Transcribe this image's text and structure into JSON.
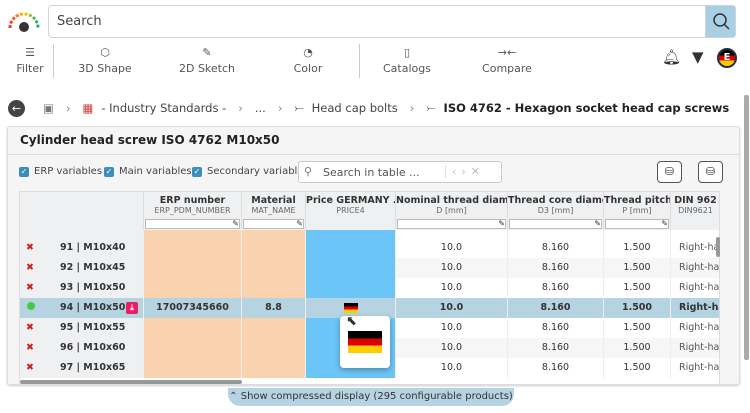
{
  "search": {
    "placeholder": "Search"
  },
  "toolbar": [
    {
      "label": "Filter",
      "icon": "sliders-icon"
    },
    {
      "label": "3D Shape",
      "icon": "cube-icon"
    },
    {
      "label": "2D Sketch",
      "icon": "pencil-icon"
    },
    {
      "label": "Color",
      "icon": "palette-icon"
    },
    {
      "label": "Catalogs",
      "icon": "book-icon"
    },
    {
      "label": "Compare",
      "icon": "compare-icon"
    }
  ],
  "user": {
    "avatar_letter": "E"
  },
  "breadcrumb": [
    "- Industry Standards -",
    "...",
    "Head cap bolts",
    "ISO 4762 - Hexagon socket head cap screws"
  ],
  "panel": {
    "title": "Cylinder head screw ISO 4762 M10x50"
  },
  "filters": {
    "erp": "ERP variables",
    "main": "Main variables",
    "secondary": "Secondary variables",
    "search_placeholder": "Search in table ..."
  },
  "columns": [
    {
      "title": "ERP number",
      "sub": "ERP_PDM_NUMBER"
    },
    {
      "title": "Material",
      "sub": "MAT_NAME"
    },
    {
      "title": "Price GERMANY ...",
      "sub": "PRICE4"
    },
    {
      "title": "Nominal thread diam...",
      "sub": "D [mm]"
    },
    {
      "title": "Thread core diame...",
      "sub": "D3 [mm]"
    },
    {
      "title": "Thread pitch",
      "sub": "P [mm]"
    },
    {
      "title": "DIN 962",
      "sub": "DIN9621"
    }
  ],
  "rows": [
    {
      "id": "91 | M10x40",
      "erp": "",
      "mat": "",
      "d": "10.0",
      "d3": "8.160",
      "p": "1.500",
      "din": "Right-har"
    },
    {
      "id": "92 | M10x45",
      "erp": "",
      "mat": "",
      "d": "10.0",
      "d3": "8.160",
      "p": "1.500",
      "din": "Right-har"
    },
    {
      "id": "93 | M10x50",
      "erp": "",
      "mat": "",
      "d": "10.0",
      "d3": "8.160",
      "p": "1.500",
      "din": "Right-har"
    },
    {
      "id": "94 | M10x50",
      "erp": "17007345660",
      "mat": "8.8",
      "d": "10.0",
      "d3": "8.160",
      "p": "1.500",
      "din": "Right-har",
      "selected": true
    },
    {
      "id": "95 | M10x55",
      "erp": "",
      "mat": "",
      "d": "10.0",
      "d3": "8.160",
      "p": "1.500",
      "din": "Right-har"
    },
    {
      "id": "96 | M10x60",
      "erp": "",
      "mat": "",
      "d": "10.0",
      "d3": "8.160",
      "p": "1.500",
      "din": "Right-har"
    },
    {
      "id": "97 | M10x65",
      "erp": "",
      "mat": "",
      "d": "10.0",
      "d3": "8.160",
      "p": "1.500",
      "din": "Right-har"
    }
  ],
  "footer": {
    "label": "Show compressed display (295 configurable products)"
  },
  "colors": {
    "erp": "#f9d2b0",
    "price": "#6cc5f7",
    "selected": "#b5d3e0"
  }
}
